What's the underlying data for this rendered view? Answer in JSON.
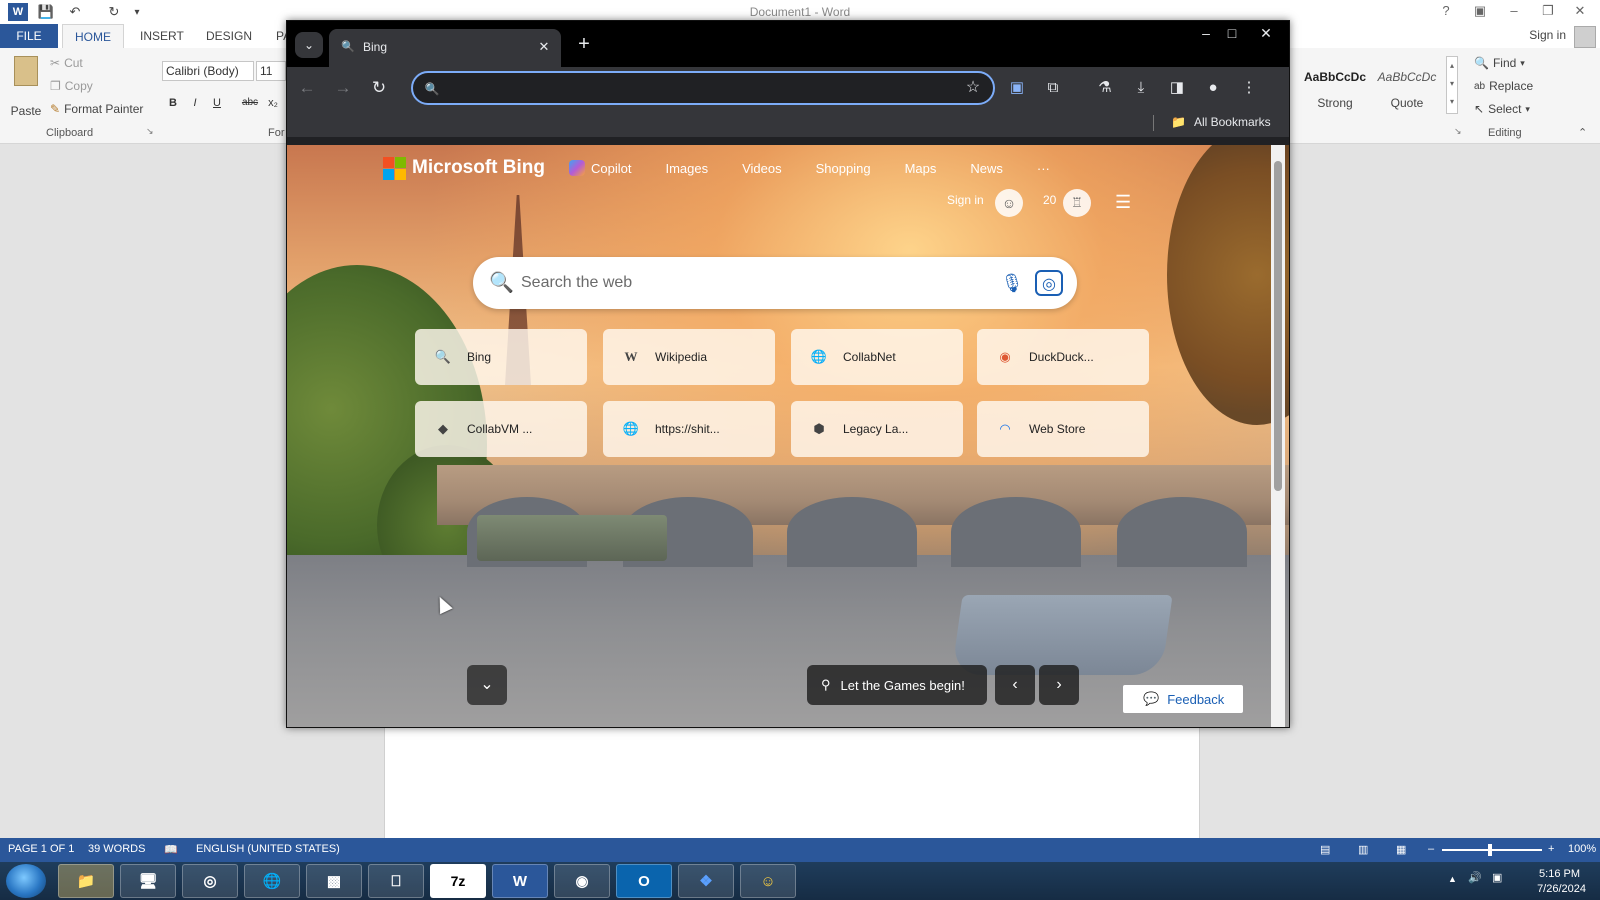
{
  "word": {
    "title": "Document1 - Word",
    "tabs": [
      "FILE",
      "HOME",
      "INSERT",
      "DESIGN",
      "PA"
    ],
    "sign_in": "Sign in",
    "clipboard": {
      "paste": "Paste",
      "cut": "Cut",
      "copy": "Copy",
      "format_painter": "Format Painter",
      "label": "Clipboard"
    },
    "font": {
      "name": "Calibri (Body)",
      "size": "11",
      "label": "For",
      "bold": "B",
      "italic": "I",
      "underline": "U",
      "strike": "abc",
      "subscript": "x₂"
    },
    "styles": [
      {
        "sample": "AaBbCcDc",
        "name": "Strong"
      },
      {
        "sample": "AaBbCcDc",
        "name": "Quote"
      }
    ],
    "editing": {
      "find": "Find",
      "replace": "Replace",
      "select": "Select",
      "label": "Editing"
    },
    "status": {
      "page": "PAGE 1 OF 1",
      "words": "39 WORDS",
      "language": "ENGLISH (UNITED STATES)",
      "zoom": "100%"
    }
  },
  "chrome": {
    "tab_title": "Bing",
    "omnibox": {
      "value": "",
      "placeholder": ""
    },
    "all_bookmarks": "All Bookmarks"
  },
  "bing": {
    "brand": "Microsoft Bing",
    "nav": [
      "Copilot",
      "Images",
      "Videos",
      "Shopping",
      "Maps",
      "News",
      "···"
    ],
    "sign_in": "Sign in",
    "points": "20",
    "search_placeholder": "Search the web",
    "tiles": [
      {
        "label": "Bing",
        "icon": "search-icon"
      },
      {
        "label": "Wikipedia",
        "icon": "wikipedia-icon"
      },
      {
        "label": "CollabNet",
        "icon": "globe-icon"
      },
      {
        "label": "DuckDuck...",
        "icon": "duckduckgo-icon"
      },
      {
        "label": "CollabVM ...",
        "icon": "collabvm-icon"
      },
      {
        "label": "https://shit...",
        "icon": "globe-icon"
      },
      {
        "label": "Legacy La...",
        "icon": "legacy-icon"
      },
      {
        "label": "Web Store",
        "icon": "webstore-icon"
      }
    ],
    "caption": "Let the Games begin!",
    "feedback": "Feedback"
  },
  "taskbar": {
    "time": "5:16 PM",
    "date": "7/26/2024",
    "apps": [
      "explorer",
      "computer",
      "browser",
      "globe",
      "winrar",
      "drive",
      "7z",
      "word",
      "obs",
      "outlook",
      "dropbox",
      "smiley"
    ]
  },
  "colors": {
    "word_blue": "#2b579a",
    "chrome_dark": "#35363a",
    "omnibox_border": "#7cacf8",
    "bing_link": "#1a5fb4"
  }
}
